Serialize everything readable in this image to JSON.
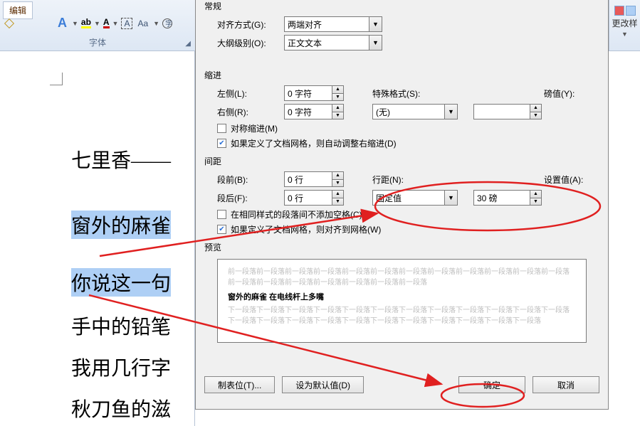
{
  "ribbon": {
    "tab_edit": "编辑",
    "group_font": "字体",
    "btn_a_effect": "A",
    "btn_highlight": "A",
    "btn_fontcolor": "A",
    "btn_char_border": "A",
    "btn_aa": "Aa",
    "btn_enclose": "字",
    "right_label": "更改样"
  },
  "doc": {
    "title": "七里香——",
    "p1": "窗外的麻雀",
    "p2": "你说这一句",
    "p3": "手中的铅笔",
    "p4": "我用几行字",
    "p5": "秋刀鱼的滋"
  },
  "dialog": {
    "section_general": "常规",
    "align_label": "对齐方式(G):",
    "align_value": "两端对齐",
    "outline_label": "大纲级别(O):",
    "outline_value": "正文文本",
    "section_indent": "缩进",
    "left_label": "左侧(L):",
    "left_value": "0 字符",
    "right_label": "右侧(R):",
    "right_value": "0 字符",
    "special_label": "特殊格式(S):",
    "special_value": "(无)",
    "by_label": "磅值(Y):",
    "by_value": "",
    "mirror_label": "对称缩进(M)",
    "adjust_label": "如果定义了文档网格，则自动调整右缩进(D)",
    "section_spacing": "间距",
    "before_label": "段前(B):",
    "before_value": "0 行",
    "after_label": "段后(F):",
    "after_value": "0 行",
    "line_label": "行距(N):",
    "line_value": "固定值",
    "at_label": "设置值(A):",
    "at_value": "30 磅",
    "nospace_label": "在相同样式的段落间不添加空格(C)",
    "snap_label": "如果定义了文档网格，则对齐到网格(W)",
    "section_preview": "预览",
    "preview_grey_before": "前一段落前一段落前一段落前一段落前一段落前一段落前一段落前一段落前一段落前一段落前一段落前一段落前一段落前一段落前一段落前一段落前一段落前一段落前一段落",
    "preview_sample": "窗外的麻雀 在电线杆上多嘴",
    "preview_grey_after": "下一段落下一段落下一段落下一段落下一段落下一段落下一段落下一段落下一段落下一段落下一段落下一段落下一段落下一段落下一段落下一段落下一段落下一段落下一段落下一段落下一段落下一段落下一段落",
    "btn_tabs": "制表位(T)...",
    "btn_default": "设为默认值(D)",
    "btn_ok": "确定",
    "btn_cancel": "取消"
  }
}
